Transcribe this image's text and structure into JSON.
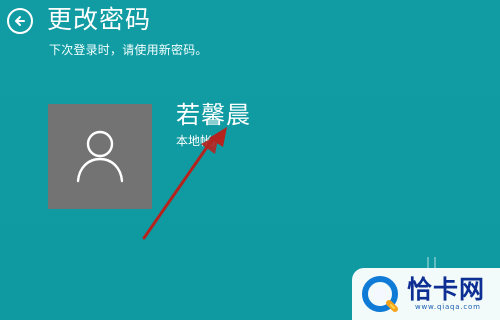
{
  "header": {
    "title": "更改密码",
    "subtitle": "下次登录时，请使用新密码。"
  },
  "account": {
    "name": "若馨晨",
    "type": "本地帐户"
  },
  "icons": {
    "back": "back-arrow-circle-icon",
    "avatar": "user-icon",
    "annotation": "red-arrow-icon",
    "watermark_logo": "qiaqa-logo-icon"
  },
  "colors": {
    "background": "#0f9aa1",
    "avatar_background": "#737373",
    "annotation": "#b5231f",
    "watermark_text": "#0d2f93"
  },
  "watermark": {
    "title": "恰卡网",
    "domain": "www.qiaqa.com"
  }
}
